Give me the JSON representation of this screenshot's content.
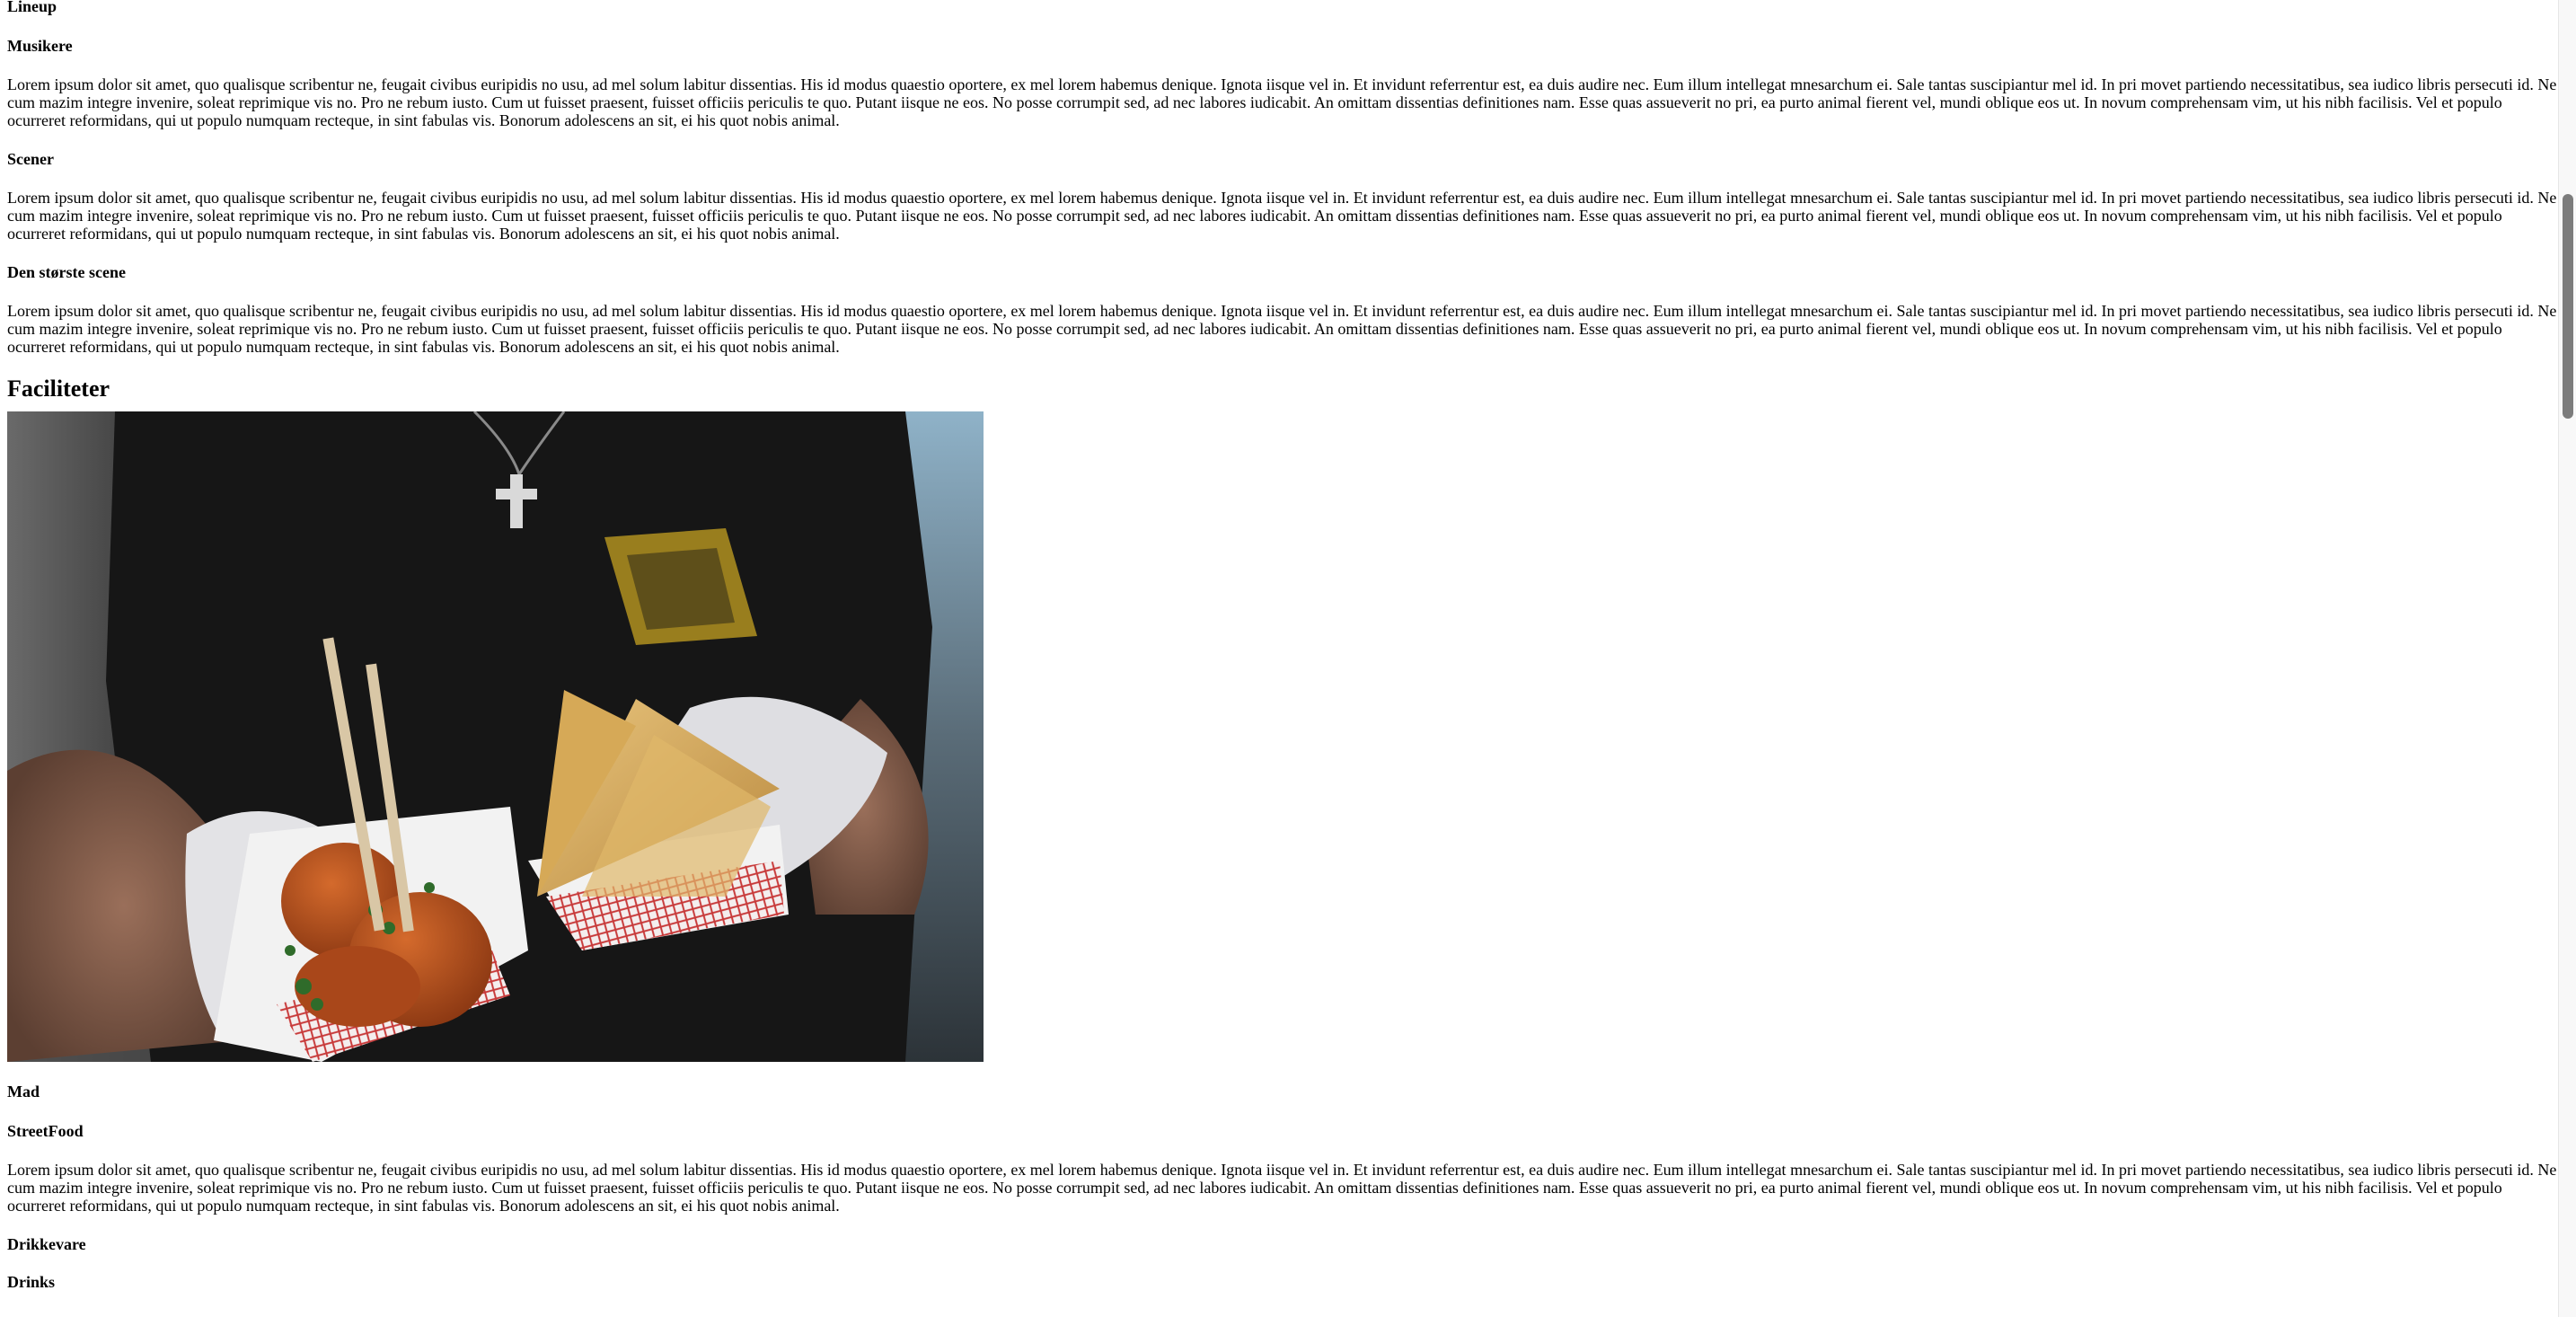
{
  "sections": {
    "lineup_title": "Lineup",
    "musikere_title": "Musikere",
    "musikere_text": "Lorem ipsum dolor sit amet, quo qualisque scribentur ne, feugait civibus euripidis no usu, ad mel solum labitur dissentias. His id modus quaestio oportere, ex mel lorem habemus denique. Ignota iisque vel in. Et invidunt referrentur est, ea duis audire nec. Eum illum intellegat mnesarchum ei. Sale tantas suscipiantur mel id. In pri movet partiendo necessitatibus, sea iudico libris persecuti id. Ne cum mazim integre invenire, soleat reprimique vis no. Pro ne rebum iusto. Cum ut fuisset praesent, fuisset officiis periculis te quo. Putant iisque ne eos. No posse corrumpit sed, ad nec labores iudicabit. An omittam dissentias definitiones nam. Esse quas assueverit no pri, ea purto animal fierent vel, mundi oblique eos ut. In novum comprehensam vim, ut his nibh facilisis. Vel et populo ocurreret reformidans, qui ut populo numquam recteque, in sint fabulas vis. Bonorum adolescens an sit, ei his quot nobis animal.",
    "scener_title": "Scener",
    "scener_text": "Lorem ipsum dolor sit amet, quo qualisque scribentur ne, feugait civibus euripidis no usu, ad mel solum labitur dissentias. His id modus quaestio oportere, ex mel lorem habemus denique. Ignota iisque vel in. Et invidunt referrentur est, ea duis audire nec. Eum illum intellegat mnesarchum ei. Sale tantas suscipiantur mel id. In pri movet partiendo necessitatibus, sea iudico libris persecuti id. Ne cum mazim integre invenire, soleat reprimique vis no. Pro ne rebum iusto. Cum ut fuisset praesent, fuisset officiis periculis te quo. Putant iisque ne eos. No posse corrumpit sed, ad nec labores iudicabit. An omittam dissentias definitiones nam. Esse quas assueverit no pri, ea purto animal fierent vel, mundi oblique eos ut. In novum comprehensam vim, ut his nibh facilisis. Vel et populo ocurreret reformidans, qui ut populo numquam recteque, in sint fabulas vis. Bonorum adolescens an sit, ei his quot nobis animal.",
    "storste_title": "Den største scene",
    "storste_text": "Lorem ipsum dolor sit amet, quo qualisque scribentur ne, feugait civibus euripidis no usu, ad mel solum labitur dissentias. His id modus quaestio oportere, ex mel lorem habemus denique. Ignota iisque vel in. Et invidunt referrentur est, ea duis audire nec. Eum illum intellegat mnesarchum ei. Sale tantas suscipiantur mel id. In pri movet partiendo necessitatibus, sea iudico libris persecuti id. Ne cum mazim integre invenire, soleat reprimique vis no. Pro ne rebum iusto. Cum ut fuisset praesent, fuisset officiis periculis te quo. Putant iisque ne eos. No posse corrumpit sed, ad nec labores iudicabit. An omittam dissentias definitiones nam. Esse quas assueverit no pri, ea purto animal fierent vel, mundi oblique eos ut. In novum comprehensam vim, ut his nibh facilisis. Vel et populo ocurreret reformidans, qui ut populo numquam recteque, in sint fabulas vis. Bonorum adolescens an sit, ei his quot nobis animal.",
    "faciliteter_title": "Faciliteter",
    "mad_title": "Mad",
    "streetfood_title": "StreetFood",
    "streetfood_text": "Lorem ipsum dolor sit amet, quo qualisque scribentur ne, feugait civibus euripidis no usu, ad mel solum labitur dissentias. His id modus quaestio oportere, ex mel lorem habemus denique. Ignota iisque vel in. Et invidunt referrentur est, ea duis audire nec. Eum illum intellegat mnesarchum ei. Sale tantas suscipiantur mel id. In pri movet partiendo necessitatibus, sea iudico libris persecuti id. Ne cum mazim integre invenire, soleat reprimique vis no. Pro ne rebum iusto. Cum ut fuisset praesent, fuisset officiis periculis te quo. Putant iisque ne eos. No posse corrumpit sed, ad nec labores iudicabit. An omittam dissentias definitiones nam. Esse quas assueverit no pri, ea purto animal fierent vel, mundi oblique eos ut. In novum comprehensam vim, ut his nibh facilisis. Vel et populo ocurreret reformidans, qui ut populo numquam recteque, in sint fabulas vis. Bonorum adolescens an sit, ei his quot nobis animal.",
    "drikkevare_title": "Drikkevare",
    "drinks_title": "Drinks"
  },
  "image": {
    "subject": "street-food-photo"
  }
}
